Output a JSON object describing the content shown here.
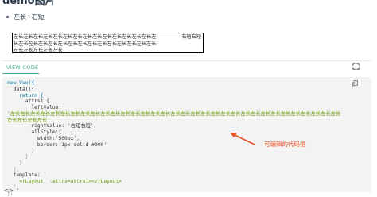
{
  "heading": "demo图片",
  "bullet": "左长+右短",
  "demo": {
    "left_text": "左长左长左长左长左长左长左长左长左长左长左长左长左长左长左长左长左长左长左长左长左长左长左长左长左长左长左长左长左长左长左长左长左长左长",
    "right_text": "右短右短"
  },
  "view_code_label": "VIEW CODE",
  "code_lines": {
    "l1": "new Vue({",
    "l2": "  data(){",
    "l3": "    return {",
    "l4": "      attrs1:{",
    "l5": "        leftValue:",
    "l6": "'左长左长左长左长左长左长左长左长左长左长左长左长左长左长左长左长左长左长左长左长左长左长左长左长左长左长左长左长左长左长左长左长左长",
    "l7": "左长左长左长左长'",
    "l8": "        rightValue: '右短右短',",
    "l9": "        allStyle:{",
    "l10": "          width:'500px',",
    "l11": "          border:'1px solid #000'",
    "l12": "        }",
    "l13": "      }",
    "l14": "    }",
    "l15": "  },",
    "l16": "  template: `",
    "l17": "    <rLayout  :attrs=attrs1></rLayout>",
    "l18": "  `,",
    "l19": "})"
  },
  "annotation": "可编辑的代码框",
  "corner_arrows": "<>",
  "colors": {
    "accent": "#3eaf7c",
    "annotation": "#e8532a",
    "code_bg": "#f3f3f3"
  },
  "icons": {
    "expand": "expand-icon",
    "copy": "copy-icon"
  }
}
